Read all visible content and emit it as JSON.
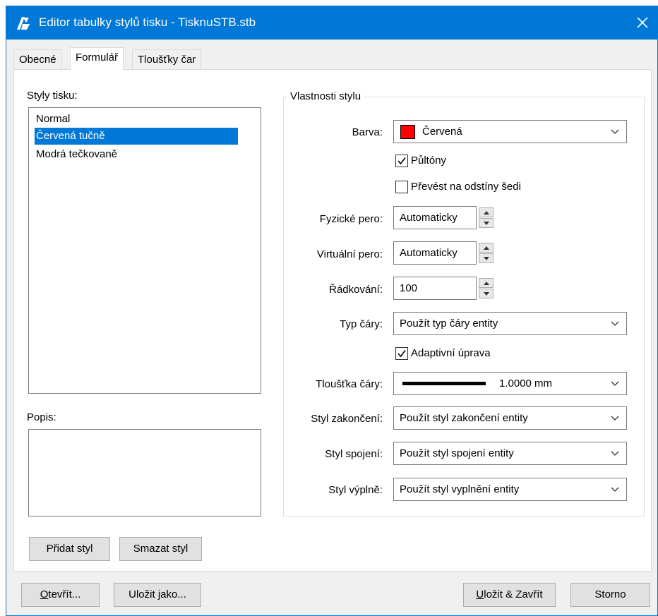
{
  "window": {
    "title": "Editor tabulky stylů tisku - TisknuSTB.stb",
    "accent_color": "#0078d7",
    "icon": "app-logo-icon",
    "close_icon": "close-icon"
  },
  "tabs": [
    {
      "label": "Obecné",
      "active": false
    },
    {
      "label": "Formulář",
      "active": true
    },
    {
      "label": "Tloušťky čar",
      "active": false
    }
  ],
  "left": {
    "styles_label": "Styly tisku:",
    "styles": [
      {
        "label": "Normal",
        "selected": false
      },
      {
        "label": "Červená tučně",
        "selected": true
      },
      {
        "label": "Modrá tečkovaně",
        "selected": false
      }
    ],
    "description_label": "Popis:",
    "description_value": "",
    "add_button": "Přidat styl",
    "delete_button": "Smazat styl"
  },
  "properties": {
    "group_title": "Vlastnosti stylu",
    "color": {
      "label": "Barva:",
      "value": "Červená",
      "swatch": "#ff0000"
    },
    "halftones": {
      "label": "Půltóny",
      "checked": true
    },
    "grayscale": {
      "label": "Převést na odstíny šedi",
      "checked": false
    },
    "physical_pen": {
      "label": "Fyzické pero:",
      "value": "Automaticky"
    },
    "virtual_pen": {
      "label": "Virtuální pero:",
      "value": "Automaticky"
    },
    "screening": {
      "label": "Řádkování:",
      "value": "100"
    },
    "linetype": {
      "label": "Typ čáry:",
      "value": "Použít typ čáry entity"
    },
    "adaptive": {
      "label": "Adaptivní úprava",
      "checked": true
    },
    "lineweight": {
      "label": "Tloušťka čáry:",
      "value": "1.0000 mm"
    },
    "line_end": {
      "label": "Styl zakončení:",
      "value": "Použít styl zakončení entity"
    },
    "line_join": {
      "label": "Styl spojení:",
      "value": "Použít styl spojení entity"
    },
    "fill": {
      "label": "Styl výplně:",
      "value": "Použít styl vyplnění entity"
    }
  },
  "footer": {
    "open_first": "O",
    "open_rest": "tevřít...",
    "save_as": "Uložit jako...",
    "save_close_first": "U",
    "save_close_rest": "ložit & Zavřít",
    "cancel": "Storno"
  }
}
